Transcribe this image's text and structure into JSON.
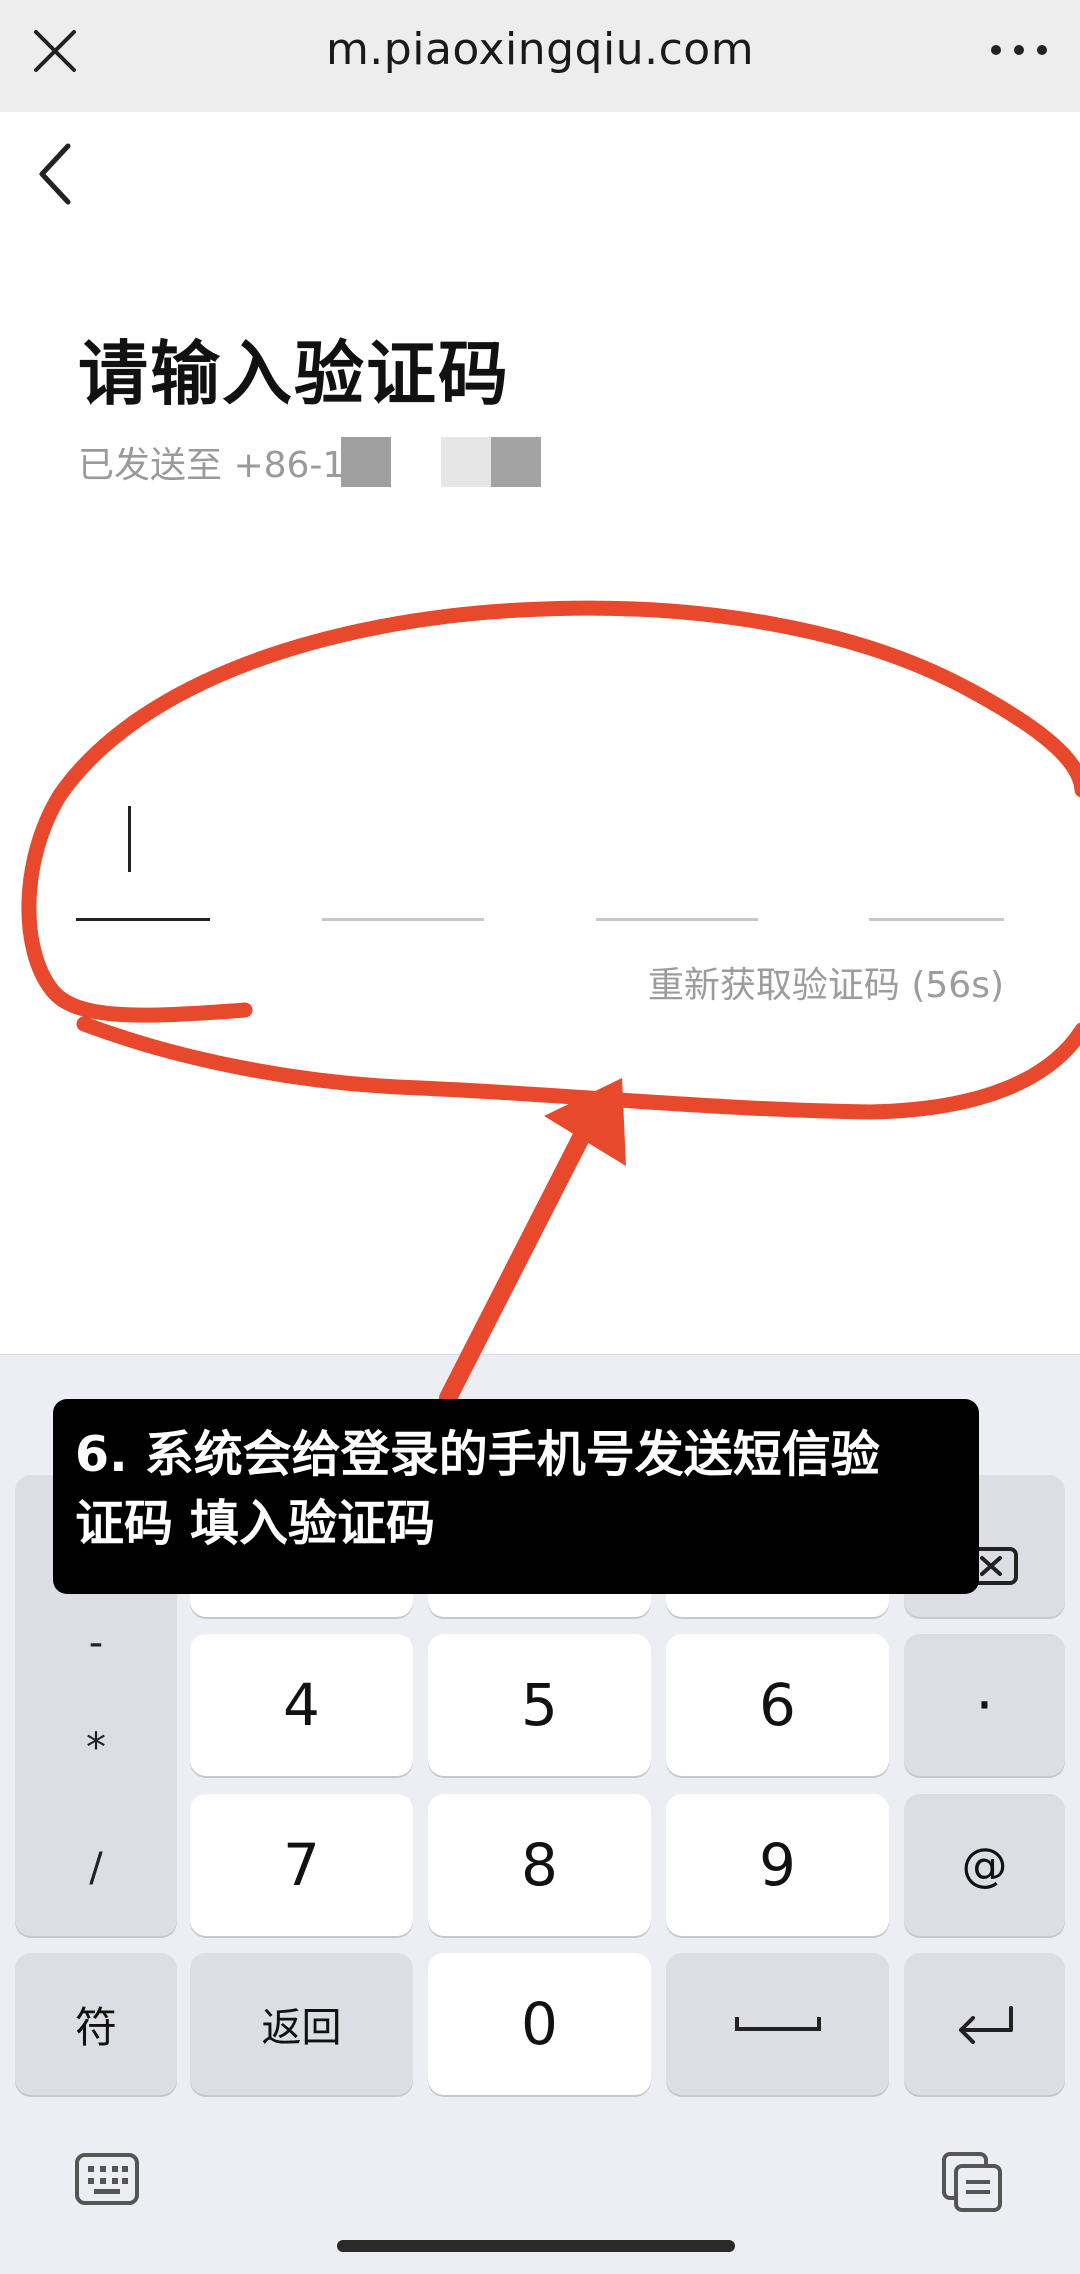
{
  "browser": {
    "url": "m.piaoxingqiu.com"
  },
  "page": {
    "title": "请输入验证码",
    "sent_to": "已发送至 +86-1",
    "resend_label": "重新获取验证码 (56s)"
  },
  "annotation": {
    "caption_line1": "6. 系统会给登录的手机号发送短信验",
    "caption_line2": "证码 填入验证码",
    "color": "#e8492c"
  },
  "keyboard": {
    "keys": {
      "k4": "4",
      "k5": "5",
      "k6": "6",
      "dot": "·",
      "k7": "7",
      "k8": "8",
      "k9": "9",
      "at": "@",
      "sym": "符",
      "back": "返回",
      "k0": "0"
    },
    "side_symbols": [
      "-",
      "*",
      "/"
    ]
  },
  "colors": {
    "browser_bar": "#ededed",
    "keyboard_bg": "#eceef3",
    "key_gray": "#dcdee4"
  }
}
